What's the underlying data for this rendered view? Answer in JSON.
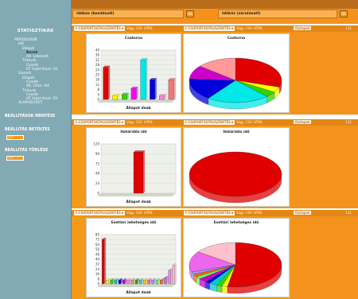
{
  "sidebar": {
    "title": "STATISZTIKÁK",
    "tree": [
      {
        "label": "PERIÓDUSOK",
        "level": 0,
        "selected": false
      },
      {
        "label": "Idő",
        "level": 1,
        "selected": false
      },
      {
        "label": "Ellapot",
        "level": 2,
        "selected": false
      },
      {
        "label": "Berek",
        "level": 3,
        "selected": true
      },
      {
        "label": "Alt. Lekezelő",
        "level": 3,
        "selected": false
      },
      {
        "label": "Tírtovat",
        "level": 2,
        "selected": false
      },
      {
        "label": "Csorék",
        "level": 3,
        "selected": false
      },
      {
        "label": "HT fejlet feszt. Ctl",
        "level": 3,
        "selected": false
      },
      {
        "label": "Szerezt",
        "level": 1,
        "selected": false
      },
      {
        "label": "Ellapot",
        "level": 2,
        "selected": false
      },
      {
        "label": "Csorék",
        "level": 3,
        "selected": false
      },
      {
        "label": "Alt. Ctlsz. Idő",
        "level": 3,
        "selected": false
      },
      {
        "label": "Tírtovat",
        "level": 2,
        "selected": false
      },
      {
        "label": "Csorék",
        "level": 3,
        "selected": false
      },
      {
        "label": "HT fejlet feszt. Ctl",
        "level": 3,
        "selected": false
      },
      {
        "label": "ALAPHELYZET",
        "level": 1,
        "selected": false
      }
    ],
    "sections": [
      {
        "label": "BEÁLLÍTÁSOK MENTÉSE",
        "select": ""
      },
      {
        "label": "BEÁLLÍTÁS BETÖLTÉS",
        "select": "???"
      },
      {
        "label": "BEÁLLÍTÁS TÖRLÉSE",
        "select": "???"
      }
    ]
  },
  "topbar": {
    "field_left": "Időköz (kezdésatl)",
    "field_right": "Időköz (zárulásatl)",
    "btn_left": "OK",
    "btn_right": "OK"
  },
  "toolbar": {
    "select_label": "F-CSOPORTOSTÁS/SZŰKÍTÉS ▾",
    "btn_vagy": "Vagy",
    "btn_csv": "CSV",
    "btn_html": "HTML",
    "right_select": "Oszlopok",
    "right_num": "111"
  },
  "charts": [
    {
      "bar": {
        "title": "Csatorna",
        "xlabel": "Állapot daab",
        "yticks": [
          "0",
          "4",
          "8",
          "12",
          "16",
          "20",
          "24",
          "28",
          "32",
          "36",
          "40"
        ]
      },
      "pie": {
        "title": "Csatorna"
      }
    },
    {
      "bar": {
        "title": "Határidős idő",
        "xlabel": "Állapot daab",
        "yticks": [
          "0",
          "24",
          "48",
          "72",
          "96",
          "120"
        ]
      },
      "pie": {
        "title": "Határidős idő"
      }
    },
    {
      "bar": {
        "title": "Esetlári lehetséges idő",
        "xlabel": "Állapot daab",
        "yticks": [
          "0",
          "8",
          "16",
          "24",
          "32",
          "40",
          "48",
          "56",
          "64",
          "72",
          "80"
        ]
      },
      "pie": {
        "title": "Esetlári lehetséges idő"
      }
    }
  ],
  "chart_data": [
    {
      "type": "bar",
      "title": "Csatorna",
      "xlabel": "Állapot daab",
      "ylim": [
        0,
        40
      ],
      "values": [
        26,
        3,
        4,
        9,
        32,
        16,
        3,
        16
      ],
      "colors": [
        "#e00000",
        "#ffff00",
        "#2dd600",
        "#ff00ff",
        "#00e8e8",
        "#0000dd",
        "#ff88dd",
        "#ee7777"
      ]
    },
    {
      "type": "pie",
      "title": "Csatorna",
      "values": [
        30,
        4,
        4,
        22,
        16,
        10,
        14
      ],
      "colors": [
        "#e00000",
        "#ffff00",
        "#2dd600",
        "#00e8e8",
        "#0000dd",
        "#cc00cc",
        "#ff9999"
      ]
    },
    {
      "type": "bar",
      "title": "Határidős idő",
      "xlabel": "Állapot daab",
      "ylim": [
        0,
        120
      ],
      "values": [
        100
      ],
      "colors": [
        "#e00000"
      ]
    },
    {
      "type": "pie",
      "title": "Határidős idő",
      "values": [
        100
      ],
      "colors": [
        "#e00000"
      ]
    },
    {
      "type": "bar",
      "title": "Esetlári lehetséges idő",
      "xlabel": "Állapot daab",
      "ylim": [
        0,
        80
      ],
      "values": [
        72,
        6,
        6,
        6,
        6,
        6,
        6,
        6,
        6,
        6,
        6,
        6,
        6,
        6,
        6,
        10,
        22,
        30
      ],
      "colors": [
        "#e00000",
        "#ffff00",
        "#2dd600",
        "#00cccc",
        "#0000dd",
        "#cc00cc",
        "#ff88dd",
        "#e0a070",
        "#22aa22",
        "#55cccc",
        "#ffcc00",
        "#ff66aa",
        "#9999ff",
        "#66ff66",
        "#ff6600",
        "#cc66ff",
        "#ee88ee",
        "#ffc0cb"
      ]
    },
    {
      "type": "pie",
      "title": "Esetlári lehetséges idő",
      "values": [
        56,
        2,
        2,
        3,
        2,
        3,
        2,
        2,
        2,
        16,
        16
      ],
      "colors": [
        "#e00000",
        "#ffff00",
        "#2dd600",
        "#00cccc",
        "#0000dd",
        "#cc00cc",
        "#66ff66",
        "#ff6600",
        "#9999ff",
        "#ee66ee",
        "#ffc0cb"
      ]
    }
  ]
}
